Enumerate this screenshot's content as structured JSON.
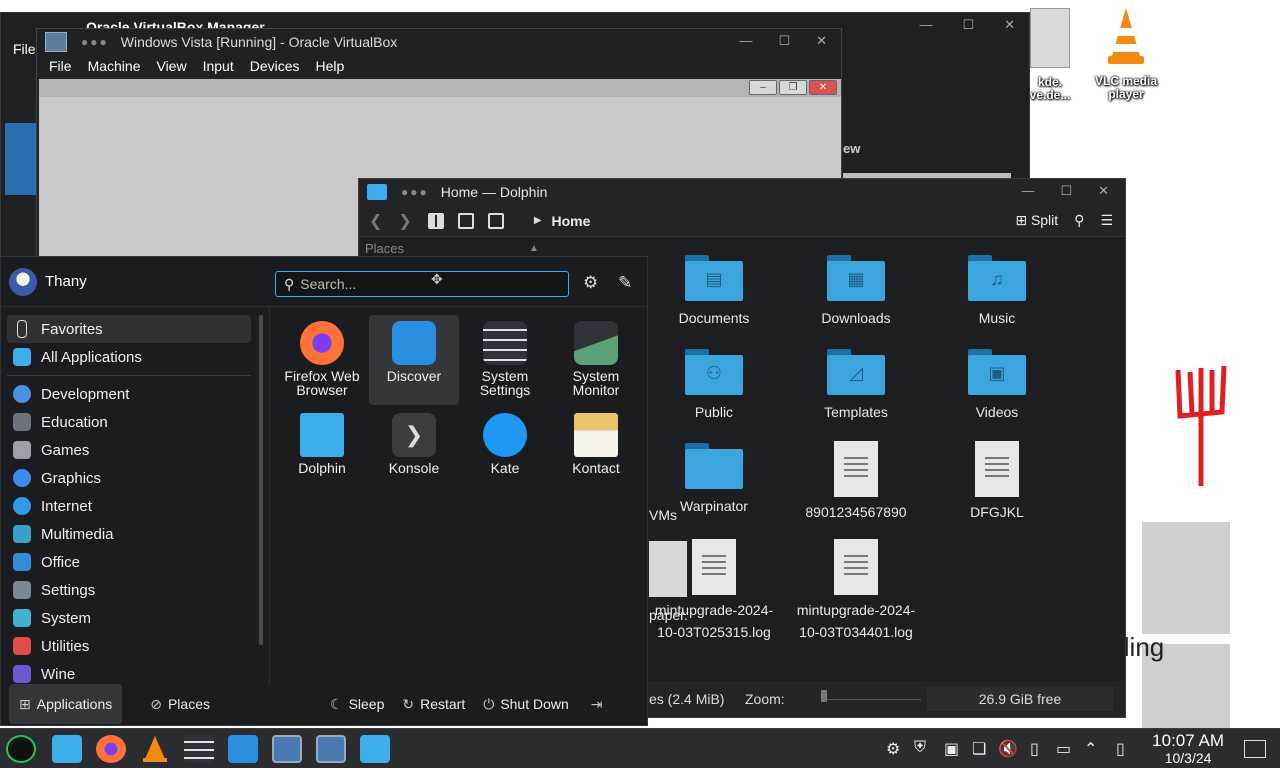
{
  "desktop": {
    "icons": [
      {
        "label_line1": "VLC media",
        "label_line2": "player"
      },
      {
        "label_line1": "kde.",
        "label_line2": "ve.de..."
      }
    ],
    "right_text": "lling"
  },
  "vbox_manager": {
    "title": "Oracle VirtualBox Manager",
    "left_fragment": "File",
    "right_fragment": "ew"
  },
  "vbox_vm": {
    "title": "Windows Vista [Running] - Oracle VirtualBox",
    "menu": [
      "File",
      "Machine",
      "View",
      "Input",
      "Devices",
      "Help"
    ]
  },
  "dolphin": {
    "title": "Home — Dolphin",
    "breadcrumb": "Home",
    "split_label": "Split",
    "places_header": "Places",
    "items": [
      {
        "name": "Documents",
        "kind": "folder",
        "glyph": "▤"
      },
      {
        "name": "Downloads",
        "kind": "folder",
        "glyph": "▦"
      },
      {
        "name": "Music",
        "kind": "folder",
        "glyph": "♫"
      },
      {
        "name": "Public",
        "kind": "folder",
        "glyph": "⚇"
      },
      {
        "name": "Templates",
        "kind": "folder",
        "glyph": "◿"
      },
      {
        "name": "Videos",
        "kind": "folder",
        "glyph": "▣"
      },
      {
        "name": "Warpinator",
        "kind": "folder",
        "glyph": ""
      },
      {
        "name": "8901234567890",
        "kind": "file"
      },
      {
        "name": "DFGJKL",
        "kind": "file"
      },
      {
        "name": "mintupgrade-2024-10-03T025315.log",
        "kind": "file",
        "line1": "mintupgrade-2024-",
        "line2": "10-03T025315.log"
      },
      {
        "name": "mintupgrade-2024-10-03T034401.log",
        "kind": "file",
        "line1": "mintupgrade-2024-",
        "line2": "10-03T034401.log"
      }
    ],
    "partial_left": [
      "VMs",
      "paper."
    ],
    "status_left": "es (2.4 MiB)",
    "zoom_label": "Zoom:",
    "free_space": "26.9 GiB free"
  },
  "launcher": {
    "user": "Thany",
    "search_placeholder": "Search...",
    "categories": [
      {
        "label": "Favorites",
        "color": "#2b2c30"
      },
      {
        "label": "All Applications",
        "color": "#3daee9"
      },
      {
        "label": "Development",
        "color": "#4a90e2"
      },
      {
        "label": "Education",
        "color": "#6b7280"
      },
      {
        "label": "Games",
        "color": "#9aa0a6"
      },
      {
        "label": "Graphics",
        "color": "#3d8bf0"
      },
      {
        "label": "Internet",
        "color": "#2e9be6"
      },
      {
        "label": "Multimedia",
        "color": "#3aa0c8"
      },
      {
        "label": "Office",
        "color": "#2f8fd8"
      },
      {
        "label": "Settings",
        "color": "#7b8794"
      },
      {
        "label": "System",
        "color": "#3fb0d0"
      },
      {
        "label": "Utilities",
        "color": "#e04b4b"
      },
      {
        "label": "Wine",
        "color": "#6a5acd"
      }
    ],
    "apps": [
      {
        "line1": "Firefox Web",
        "line2": "Browser",
        "color": "#ff7139"
      },
      {
        "line1": "Discover",
        "line2": "",
        "color": "#2a8fe0"
      },
      {
        "line1": "System",
        "line2": "Settings",
        "color": "#2f3238"
      },
      {
        "line1": "System",
        "line2": "Monitor",
        "color": "#5aa37a"
      },
      {
        "line1": "Dolphin",
        "line2": "",
        "color": "#3daee9"
      },
      {
        "line1": "Konsole",
        "line2": "",
        "color": "#3a3d42"
      },
      {
        "line1": "Kate",
        "line2": "",
        "color": "#1d99f3"
      },
      {
        "line1": "Kontact",
        "line2": "",
        "color": "#e9c46a"
      }
    ],
    "footer": {
      "applications": "Applications",
      "places": "Places",
      "sleep": "Sleep",
      "restart": "Restart",
      "shutdown": "Shut Down"
    }
  },
  "taskbar": {
    "time": "10:07 AM",
    "date": "10/3/24"
  }
}
